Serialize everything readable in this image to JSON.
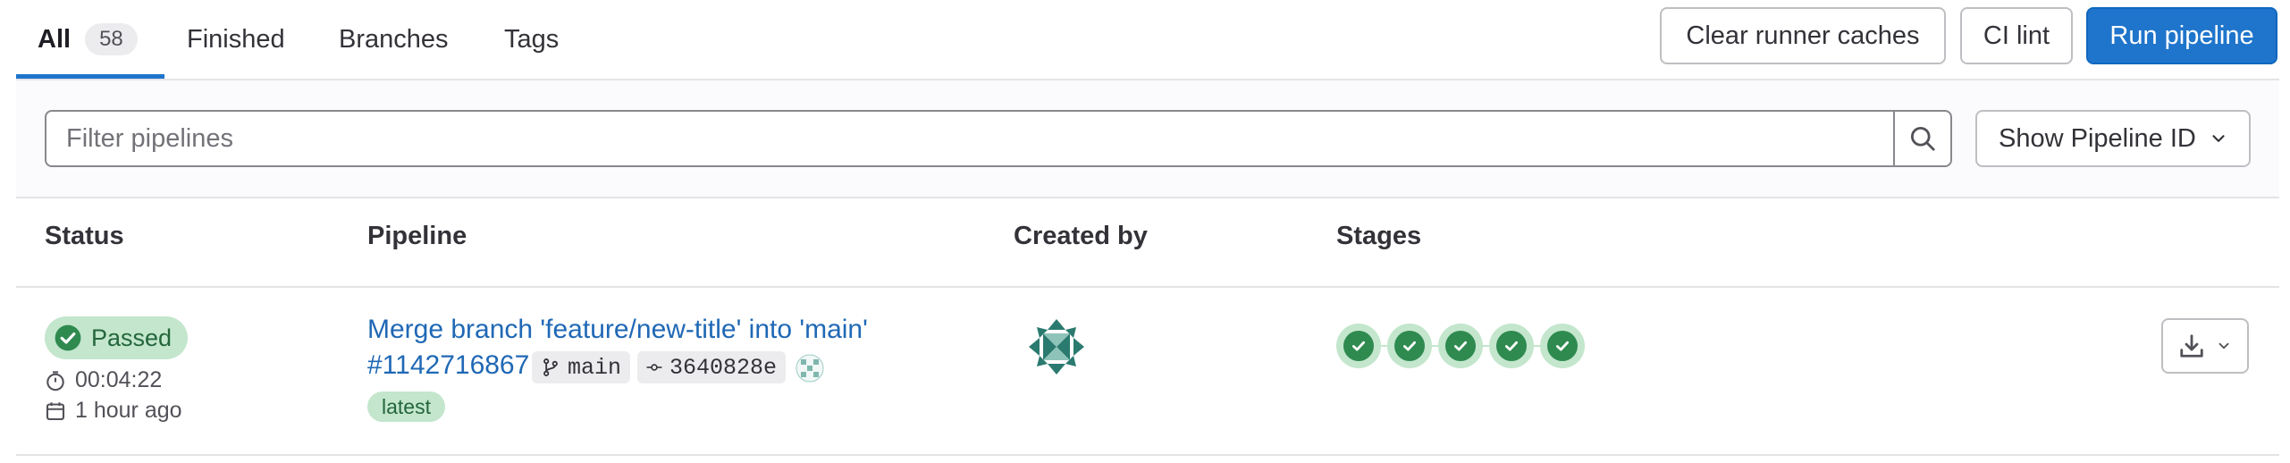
{
  "tabs": [
    {
      "label": "All",
      "count": "58",
      "active": true
    },
    {
      "label": "Finished"
    },
    {
      "label": "Branches"
    },
    {
      "label": "Tags"
    }
  ],
  "actions": {
    "clear_caches": "Clear runner caches",
    "ci_lint": "CI lint",
    "run_pipeline": "Run pipeline"
  },
  "filter": {
    "placeholder": "Filter pipelines",
    "value": "",
    "display_option": "Show Pipeline ID"
  },
  "table": {
    "headers": [
      "Status",
      "Pipeline",
      "Created by",
      "Stages"
    ],
    "rows": [
      {
        "status": "Passed",
        "duration": "00:04:22",
        "finished": "1 hour ago",
        "commit_title": "Merge branch 'feature/new-title' into 'main'",
        "pipeline_id": "#1142716867",
        "ref": "main",
        "sha": "3640828e",
        "badge": "latest",
        "stages": [
          "passed",
          "passed",
          "passed",
          "passed",
          "passed"
        ]
      }
    ]
  },
  "icons": {
    "search": "search-icon",
    "chevron": "chevron-down-icon",
    "branch": "branch-icon",
    "commit": "commit-icon",
    "timer": "timer-icon",
    "calendar": "calendar-icon",
    "status": "check-circle-icon",
    "download": "download-icon",
    "avatar": "identicon-avatar"
  },
  "colors": {
    "primary": "#1f75cb",
    "link": "#1f68b5",
    "success_bg": "#c3e6cd",
    "success_fg": "#2f8a4f",
    "avatar": "#2b7a6f"
  }
}
